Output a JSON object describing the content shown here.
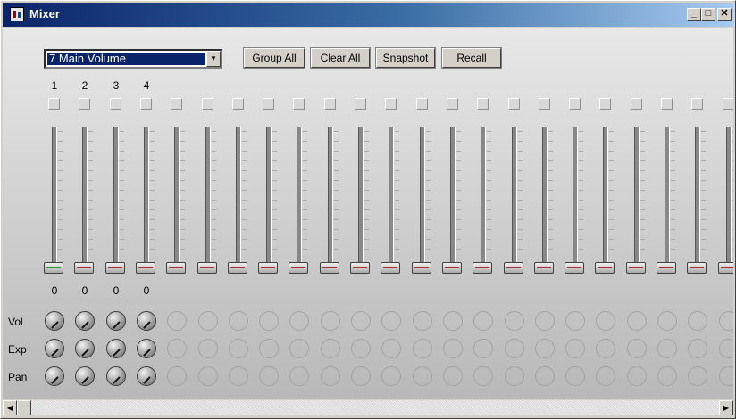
{
  "window": {
    "title": "Mixer",
    "minimize_glyph": "_",
    "maximize_glyph": "□",
    "close_glyph": "✕"
  },
  "toolbar": {
    "controller_select": "7 Main Volume",
    "select_arrow": "▼",
    "group_all": "Group All",
    "clear_all": "Clear All",
    "snapshot": "Snapshot",
    "recall": "Recall"
  },
  "channel_numbers": [
    "1",
    "2",
    "3",
    "4"
  ],
  "fader_values": [
    "0",
    "0",
    "0",
    "0"
  ],
  "channel_count_visible": 23,
  "rows": {
    "vol": "Vol",
    "exp": "Exp",
    "pan": "Pan"
  },
  "scrollbar": {
    "left_arrow": "◀",
    "right_arrow": "▶"
  },
  "colors": {
    "title_start": "#0a246a",
    "title_end": "#a6caf0",
    "active_fader": "#2f9a2f",
    "fader_stripe": "#b03030"
  }
}
